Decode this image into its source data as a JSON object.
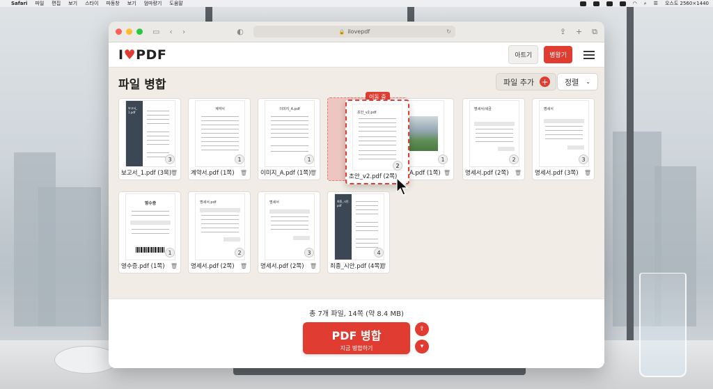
{
  "menubar": {
    "app": "Safari",
    "items": [
      "파일",
      "편집",
      "보기",
      "스타이",
      "파동창",
      "보기",
      "엄마량기",
      "도움말"
    ],
    "right_text": "오스도 2560×1440"
  },
  "browser": {
    "url": "ilovepdf"
  },
  "header": {
    "logo_i": "I",
    "logo_pdf": "PDF",
    "login_label": "아트기",
    "signup_label": "병왕기"
  },
  "workspace": {
    "title": "파일 병합",
    "add_file_label": "파일 추가",
    "sort_label": "정렬",
    "moving_label": "이동 중"
  },
  "files": [
    {
      "name": "보고서_1.pdf (3목)",
      "pages": "3",
      "thumb_text": "보고서_\n1.pdf"
    },
    {
      "name": "계약서.pdf (1쪽)",
      "pages": "1",
      "thumb_title": "계약서"
    },
    {
      "name": "이미지_A.pdf (1쪽)",
      "pages": "1",
      "thumb_title": "이미지_A.pdf"
    },
    {
      "name": "A.pdf (1쪽)",
      "pages": "1"
    },
    {
      "name": "명세서.pdf (2쪽)",
      "pages": "2",
      "thumb_title": "명세서/세금"
    },
    {
      "name": "명세서.pdf (3쪽)",
      "pages": "3",
      "thumb_title": "명세서"
    },
    {
      "name": "영수증.pdf (1쪽)",
      "pages": "1",
      "thumb_title": "영수증"
    },
    {
      "name": "명세서.pdf (2쪽)",
      "pages": "2",
      "thumb_title": "명세서.pdf"
    },
    {
      "name": "명세서.pdf (2쪽)",
      "pages": "3",
      "thumb_title": "명세서"
    },
    {
      "name": "최종_시안.pdf (4쪽)",
      "pages": "4",
      "thumb_text": "최종_시안.\npdf"
    }
  ],
  "dragging": {
    "name": "초안_v2.pdf (2쪽)",
    "pages": "2",
    "thumb_title": "초안_v2.pdf"
  },
  "footer": {
    "summary": "총 7개 파일, 14쪽 (약 8.4 MB)",
    "merge_label": "PDF 병합",
    "merge_sub": "지금 병합하기"
  },
  "colors": {
    "accent": "#e03c31"
  }
}
